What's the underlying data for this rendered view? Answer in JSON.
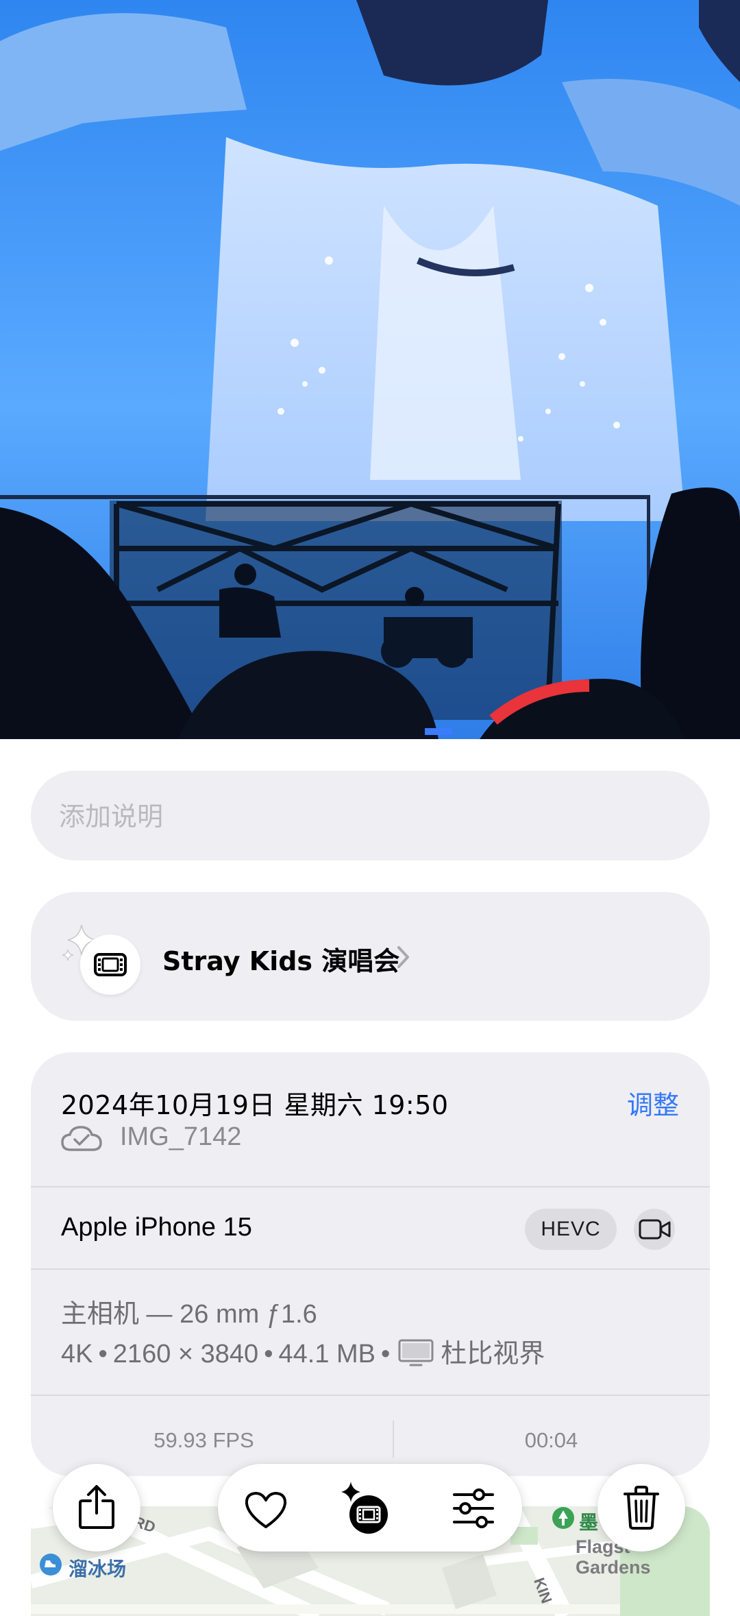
{
  "caption": {
    "placeholder": "添加说明"
  },
  "memory": {
    "title": "Stray Kids 演唱会"
  },
  "info": {
    "datetime": "2024年10月19日 星期六 19:50",
    "adjust_label": "调整",
    "filename": "IMG_7142",
    "device": "Apple iPhone 15",
    "codec_badge": "HEVC",
    "lens": "主相机 — 26 mm ƒ1.6",
    "resolution_class": "4K",
    "dimensions": "2160 × 3840",
    "file_size": "44.1 MB",
    "hdr": "杜比视界",
    "fps": "59.93 FPS",
    "duration": "00:04",
    "separator": "•"
  },
  "map": {
    "rink_label": "溜冰场",
    "ink_label": "墨",
    "garden_label_line1": "Flagst",
    "garden_label_line2": "Gardens",
    "road_label_1": "RD",
    "road_label_2": "KIN"
  },
  "toolbar": {
    "share_icon": "share-icon",
    "favorite_icon": "heart-icon",
    "memory_icon": "sparkle-film-icon",
    "adjust_icon": "sliders-icon",
    "delete_icon": "trash-icon"
  },
  "colors": {
    "accent": "#3478f6",
    "card_bg": "#eeeef3",
    "secondary_text": "#8a8a8e"
  }
}
